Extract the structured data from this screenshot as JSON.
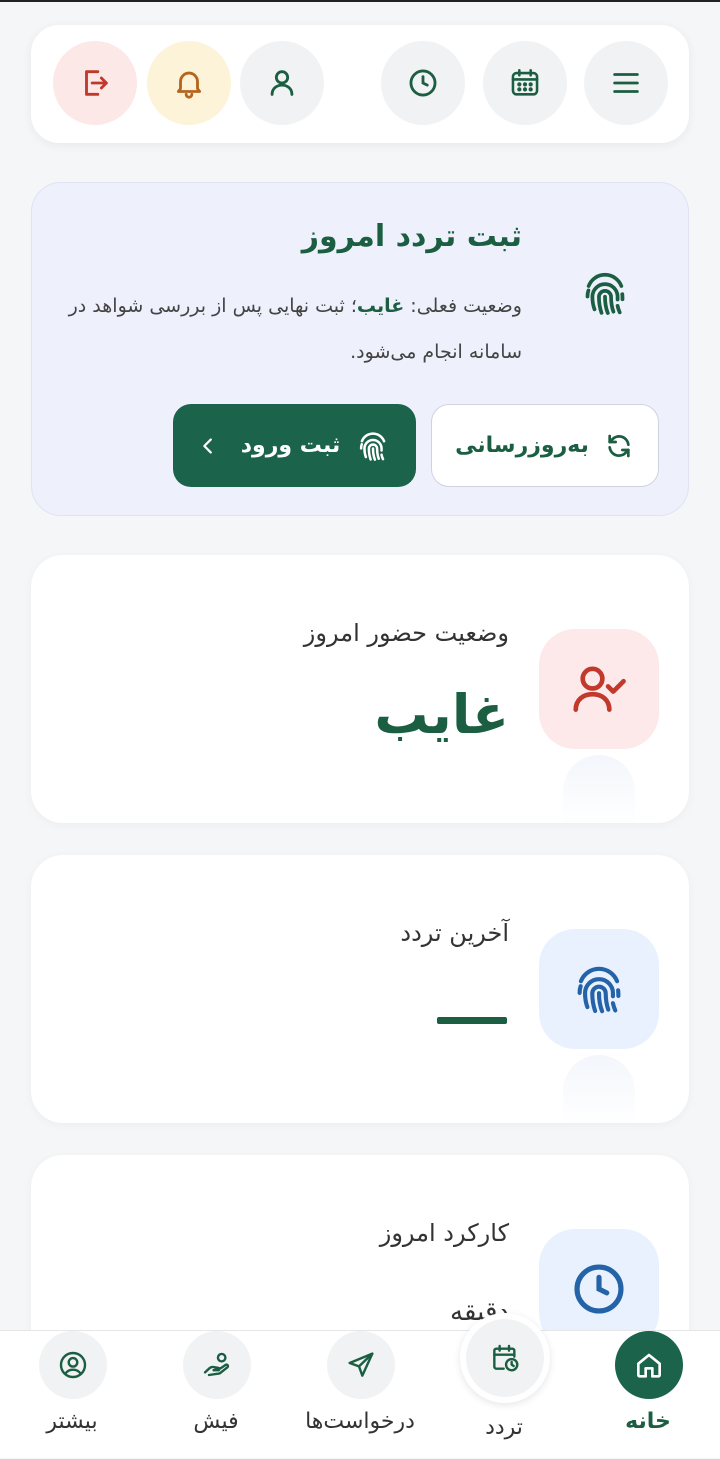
{
  "toolbar": {
    "menu_icon": "menu-icon",
    "calendar_icon": "calendar-icon",
    "clock_icon": "clock-icon",
    "profile_icon": "user-icon",
    "notifications_icon": "bell-icon",
    "logout_icon": "logout-icon"
  },
  "register": {
    "title": "ثبت تردد امروز",
    "desc_prefix": "وضعیت فعلی: ",
    "desc_status": "غایب",
    "desc_suffix": "؛ ثبت نهایی پس از بررسی شواهد در سامانه انجام می‌شود.",
    "refresh_label": "به‌روزرسانی",
    "enter_label": "ثبت ورود"
  },
  "stats": {
    "presence_label": "وضعیت حضور امروز",
    "presence_value": "غایب",
    "last_traffic_label": "آخرین تردد",
    "last_traffic_value": "—",
    "work_label": "کارکرد امروز",
    "work_value_partial": "دقیقه"
  },
  "nav": {
    "home": "خانه",
    "traffic": "تردد",
    "requests": "درخواست‌ها",
    "fish": "فیش",
    "more": "بیشتر"
  },
  "colors": {
    "primary": "#1b634a",
    "danger": "#c0392b",
    "info": "#2563a8",
    "bell": "#b5651d"
  }
}
